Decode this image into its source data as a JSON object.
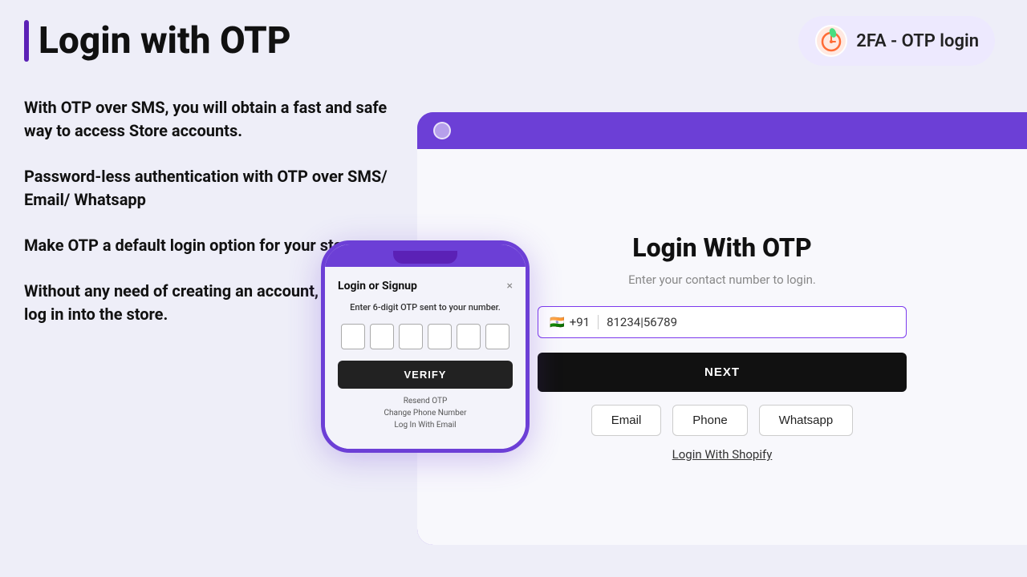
{
  "header": {
    "title": "Login with OTP",
    "badge_text": "2FA - OTP login"
  },
  "features": [
    {
      "id": "feature-1",
      "text": "With OTP over SMS, you will obtain a fast and safe way to access Store accounts."
    },
    {
      "id": "feature-2",
      "text": "Password-less authentication with OTP over SMS/ Email/ Whatsapp"
    },
    {
      "id": "feature-3",
      "text": "Make OTP a default login option for your store."
    },
    {
      "id": "feature-4",
      "text": "Without any need of creating an account, you can log in into the store."
    }
  ],
  "browser_mockup": {
    "login_card": {
      "title": "Login With OTP",
      "subtitle": "Enter your contact number to login.",
      "phone_flag": "🇮🇳",
      "phone_code": "+91",
      "phone_value": "81234|56789",
      "next_button": "NEXT",
      "channels": [
        "Email",
        "Phone",
        "Whatsapp"
      ],
      "shopify_link": "Login With Shopify"
    }
  },
  "phone_mockup": {
    "modal_title": "Login or Signup",
    "modal_close": "×",
    "modal_subtitle": "Enter 6-digit OTP sent to your number.",
    "otp_count": 6,
    "verify_button": "VERIFY",
    "links": [
      "Resend OTP",
      "Change Phone Number",
      "Log In With Email"
    ]
  },
  "colors": {
    "purple": "#6c3fd6",
    "dark_purple": "#5b21b6",
    "black": "#111111",
    "badge_bg": "#ede9fe"
  }
}
